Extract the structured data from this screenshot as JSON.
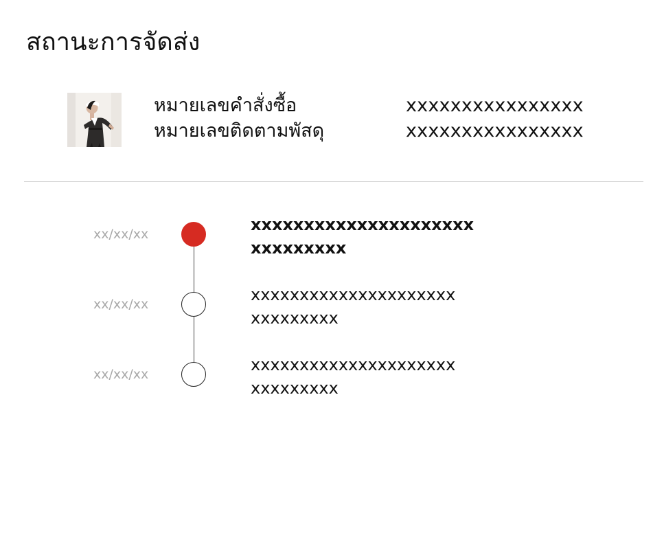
{
  "page": {
    "title": "สถานะการจัดส่ง"
  },
  "order": {
    "thumbnail_alt": "product-photo",
    "order_number_label": "หมายเลขคำสั่งซื้อ",
    "order_number_value": "xxxxxxxxxxxxxxxx",
    "tracking_number_label": "หมายเลขติดตามพัสดุ",
    "tracking_number_value": "xxxxxxxxxxxxxxxx"
  },
  "timeline": {
    "events": [
      {
        "date": "xx/xx/xx",
        "line1": "xxxxxxxxxxxxxxxxxxxxx",
        "line2": "xxxxxxxxx",
        "active": true
      },
      {
        "date": "xx/xx/xx",
        "line1": "xxxxxxxxxxxxxxxxxxxxx",
        "line2": "xxxxxxxxx",
        "active": false
      },
      {
        "date": "xx/xx/xx",
        "line1": "xxxxxxxxxxxxxxxxxxxxx",
        "line2": "xxxxxxxxx",
        "active": false
      }
    ]
  },
  "colors": {
    "active_dot": "#d62b22",
    "date_text": "#a8a8a8",
    "divider": "#cccccc"
  }
}
